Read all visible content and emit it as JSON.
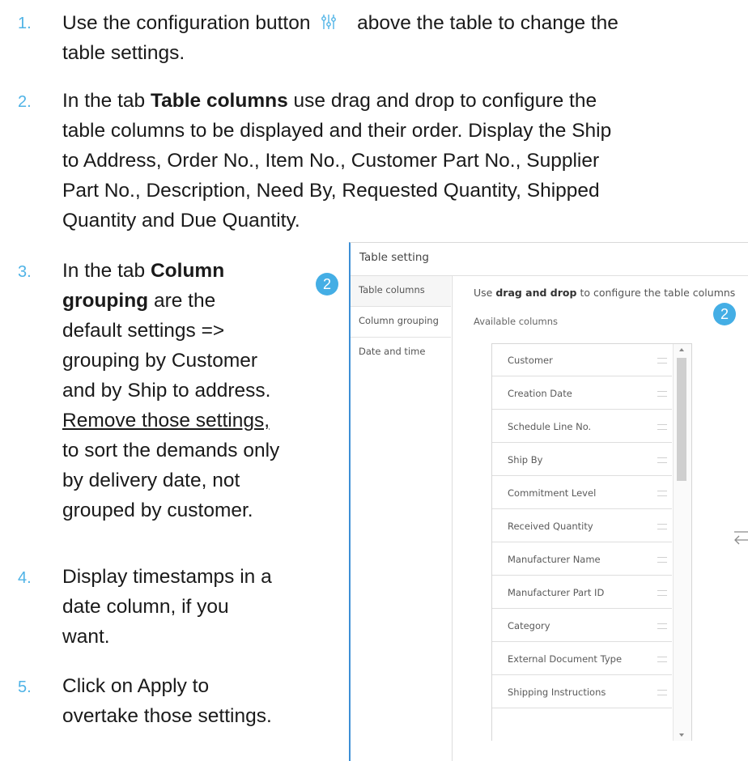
{
  "steps": [
    {
      "number": "1.",
      "text_before_icon": "Use the configuration button",
      "icon": "config-sliders-icon",
      "text_after_icon": "above the table to change the",
      "line2": "table settings."
    },
    {
      "number": "2.",
      "prefix": "In the tab ",
      "bold": "Table columns",
      "suffix": " use drag and drop to configure the",
      "line2": "table columns to be displayed and their order. Display the Ship",
      "line3": "to Address, Order No., Item No., Customer Part No., Supplier",
      "line4": "Part No., Description, Need By, Requested Quantity, Shipped",
      "line5": "Quantity and Due Quantity."
    },
    {
      "number": "3.",
      "prefix": "In the tab ",
      "bold1": "Column",
      "bold2": "grouping",
      "suffix": " are the",
      "line3": "default settings =>",
      "line4": "grouping by Customer",
      "line5": "and by Ship to address.",
      "underlined": "Remove those settings,",
      "line7": "to sort the demands only",
      "line8": "by delivery date, not",
      "line9": "grouped by customer."
    },
    {
      "number": "4.",
      "line1": "Display timestamps in a",
      "line2": "date column, if you",
      "line3": "want."
    },
    {
      "number": "5.",
      "line1": "Click on Apply to",
      "line2": "overtake those settings."
    }
  ],
  "panel": {
    "title": "Table setting",
    "tabs": [
      "Table columns",
      "Column grouping",
      "Date and time"
    ],
    "active_tab": "Table columns",
    "badge_left": "2",
    "badge_right": "2",
    "instruction_prefix": "Use ",
    "instruction_bold": "drag and drop",
    "instruction_suffix": " to configure the table columns",
    "available_label": "Available columns",
    "available_columns": [
      "Customer",
      "Creation Date",
      "Schedule Line No.",
      "Ship By",
      "Commitment Level",
      "Received Quantity",
      "Manufacturer Name",
      "Manufacturer Part ID",
      "Category",
      "External Document Type",
      "Shipping Instructions"
    ]
  }
}
